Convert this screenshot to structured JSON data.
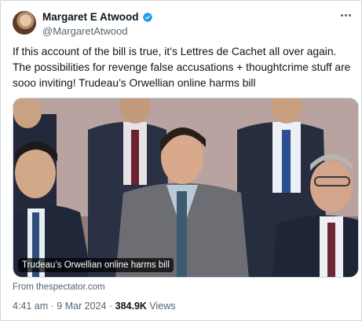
{
  "author": {
    "name": "Margaret E Atwood",
    "handle": "@MargaretAtwood",
    "verified": true
  },
  "tweet": {
    "text": "If this account of the bill is true, it’s Lettres de Cachet all over again. The possibilities for revenge false accusations + thoughtcrime stuff are sooo inviting! Trudeau’s Orwellian online harms bill"
  },
  "media": {
    "caption": "Trudeau’s Orwellian online harms bill",
    "source": "From thespectator.com"
  },
  "meta": {
    "time": "4:41 am",
    "separator": " · ",
    "date": "9 Mar 2024",
    "views_count": "384.9K",
    "views_label": "Views"
  },
  "colors": {
    "verified_badge": "#1d9bf0",
    "secondary_text": "#536471"
  },
  "icons": {
    "more": "more-options-icon",
    "verified": "verified-badge-icon"
  }
}
